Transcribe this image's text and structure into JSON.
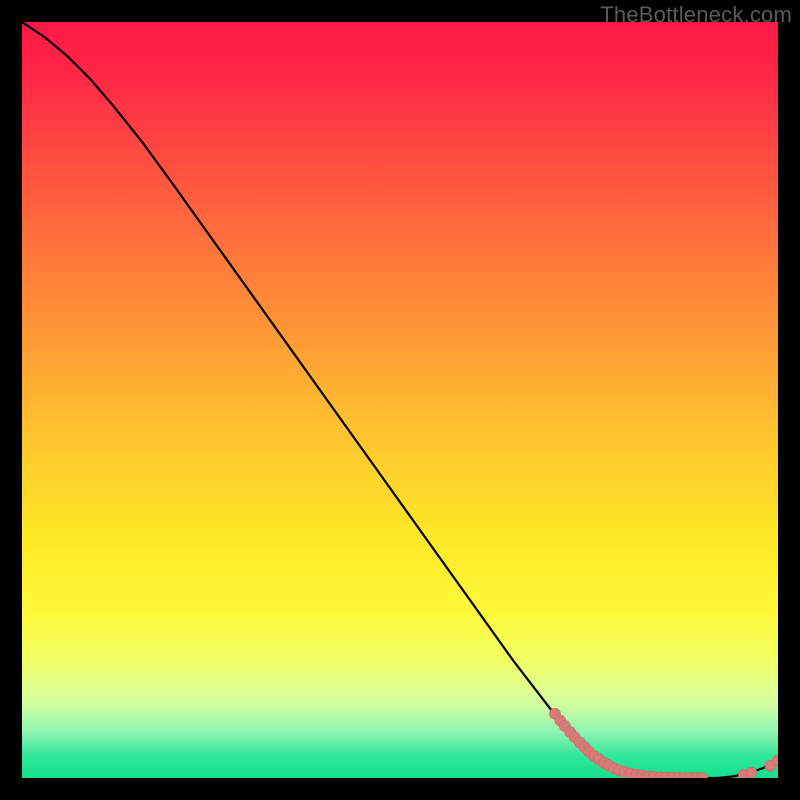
{
  "watermark": "TheBottleneck.com",
  "colors": {
    "curve": "#000000",
    "point_fill": "#d87a77",
    "point_stroke": "#c96a66"
  },
  "chart_data": {
    "type": "line",
    "title": "",
    "xlabel": "",
    "ylabel": "",
    "xlim": [
      0,
      100
    ],
    "ylim": [
      0,
      100
    ],
    "x": [
      0,
      3,
      6,
      9,
      12,
      16,
      20,
      25,
      30,
      35,
      40,
      45,
      50,
      55,
      60,
      65,
      70,
      74,
      77,
      80,
      82,
      84,
      86,
      88,
      90,
      92,
      94,
      96,
      98,
      100
    ],
    "values": [
      100,
      98,
      95.5,
      92.5,
      89,
      84,
      78.5,
      71.5,
      64.5,
      57.5,
      50.5,
      43.5,
      36.5,
      29.5,
      22.5,
      15.5,
      9.0,
      4.5,
      2.2,
      0.9,
      0.4,
      0.15,
      0.05,
      0.0,
      0.0,
      0.0,
      0.2,
      0.6,
      1.3,
      2.3
    ],
    "scatter_points": [
      {
        "x": 70.5,
        "y": 8.5
      },
      {
        "x": 71.2,
        "y": 7.6
      },
      {
        "x": 71.8,
        "y": 6.9
      },
      {
        "x": 72.5,
        "y": 6.1
      },
      {
        "x": 73.1,
        "y": 5.4
      },
      {
        "x": 73.8,
        "y": 4.7
      },
      {
        "x": 74.4,
        "y": 4.1
      },
      {
        "x": 75.0,
        "y": 3.5
      },
      {
        "x": 75.7,
        "y": 2.9
      },
      {
        "x": 76.3,
        "y": 2.5
      },
      {
        "x": 77.0,
        "y": 2.0
      },
      {
        "x": 77.6,
        "y": 1.7
      },
      {
        "x": 78.3,
        "y": 1.3
      },
      {
        "x": 79.0,
        "y": 1.0
      },
      {
        "x": 79.7,
        "y": 0.8
      },
      {
        "x": 80.5,
        "y": 0.6
      },
      {
        "x": 81.3,
        "y": 0.45
      },
      {
        "x": 82.0,
        "y": 0.32
      },
      {
        "x": 82.8,
        "y": 0.22
      },
      {
        "x": 83.6,
        "y": 0.14
      },
      {
        "x": 84.4,
        "y": 0.08
      },
      {
        "x": 85.2,
        "y": 0.04
      },
      {
        "x": 86.0,
        "y": 0.02
      },
      {
        "x": 86.8,
        "y": 0.0
      },
      {
        "x": 87.6,
        "y": 0.0
      },
      {
        "x": 88.4,
        "y": 0.0
      },
      {
        "x": 89.2,
        "y": 0.0
      },
      {
        "x": 90.0,
        "y": 0.0
      },
      {
        "x": 95.5,
        "y": 0.4
      },
      {
        "x": 96.5,
        "y": 0.7
      },
      {
        "x": 99.0,
        "y": 1.6
      },
      {
        "x": 100.0,
        "y": 2.3
      }
    ]
  }
}
